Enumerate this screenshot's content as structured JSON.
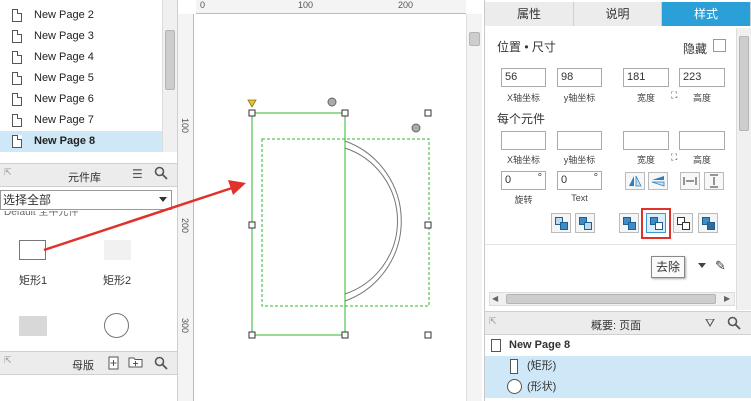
{
  "pages": {
    "items": [
      {
        "label": "New Page 2"
      },
      {
        "label": "New Page 3"
      },
      {
        "label": "New Page 4"
      },
      {
        "label": "New Page 5"
      },
      {
        "label": "New Page 6"
      },
      {
        "label": "New Page 7"
      },
      {
        "label": "New Page 8",
        "selected": true
      }
    ]
  },
  "library": {
    "title": "元件库",
    "select_value": "选择全部",
    "partial_text": "Default  全中元件",
    "widgets": [
      {
        "label": "矩形1",
        "icon": "rectangle-outline-icon"
      },
      {
        "label": "矩形2",
        "icon": "rectangle-filled-icon"
      },
      {
        "label": "",
        "icon": "rectangle-gray-icon"
      },
      {
        "label": "",
        "icon": "circle-icon"
      }
    ]
  },
  "masters": {
    "title": "母版"
  },
  "rulers": {
    "top": [
      "0",
      "100",
      "200"
    ],
    "left": [
      "100",
      "200",
      "300"
    ]
  },
  "inspector": {
    "tabs": [
      "属性",
      "说明",
      "样式"
    ],
    "active_tab": "样式",
    "position_size_title": "位置 • 尺寸",
    "hide_label": "隐藏",
    "x": "56",
    "y": "98",
    "width": "181",
    "height": "223",
    "x_label": "X轴坐标",
    "y_label": "y轴坐标",
    "w_label": "宽度",
    "h_label": "高度",
    "each_title": "每个元件",
    "each_x": "",
    "each_y": "",
    "each_w": "",
    "each_h": "",
    "rotate_value": "0",
    "rotate_label": "旋转",
    "text_rot_value": "0",
    "text_rot_label": "Text",
    "degree": "°",
    "tooltip": "去除",
    "highlight_color": "#e0312b",
    "accent_color": "#2a9fd8"
  },
  "outline": {
    "title": "概要: 页面",
    "page": "New Page 8",
    "items": [
      {
        "label": "(矩形)",
        "icon": "rectangle-outline-icon"
      },
      {
        "label": "(形状)",
        "icon": "circle-outline-icon"
      }
    ]
  }
}
